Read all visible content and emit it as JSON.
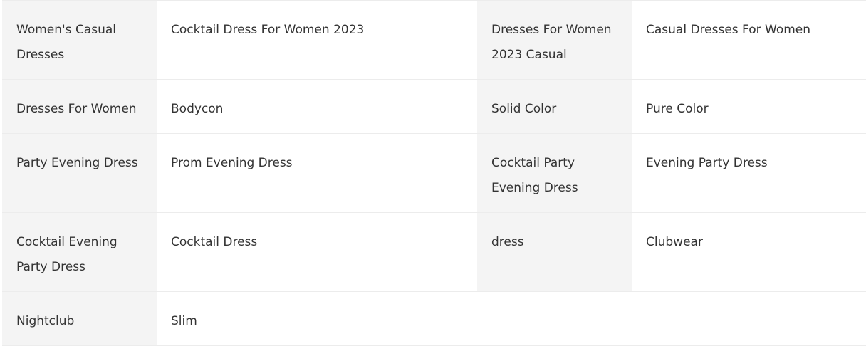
{
  "rows": [
    [
      "Women's Casual Dresses",
      "Cocktail Dress For Women 2023",
      "Dresses For Women 2023 Casual",
      "Casual Dresses For Women"
    ],
    [
      "Dresses For Women",
      "Bodycon",
      "Solid Color",
      "Pure Color"
    ],
    [
      "Party Evening Dress",
      "Prom Evening Dress",
      "Cocktail Party Evening Dress",
      "Evening Party Dress"
    ],
    [
      "Cocktail Evening Party Dress",
      "Cocktail Dress",
      "dress",
      "Clubwear"
    ],
    [
      "Nightclub",
      "Slim",
      "",
      ""
    ]
  ]
}
